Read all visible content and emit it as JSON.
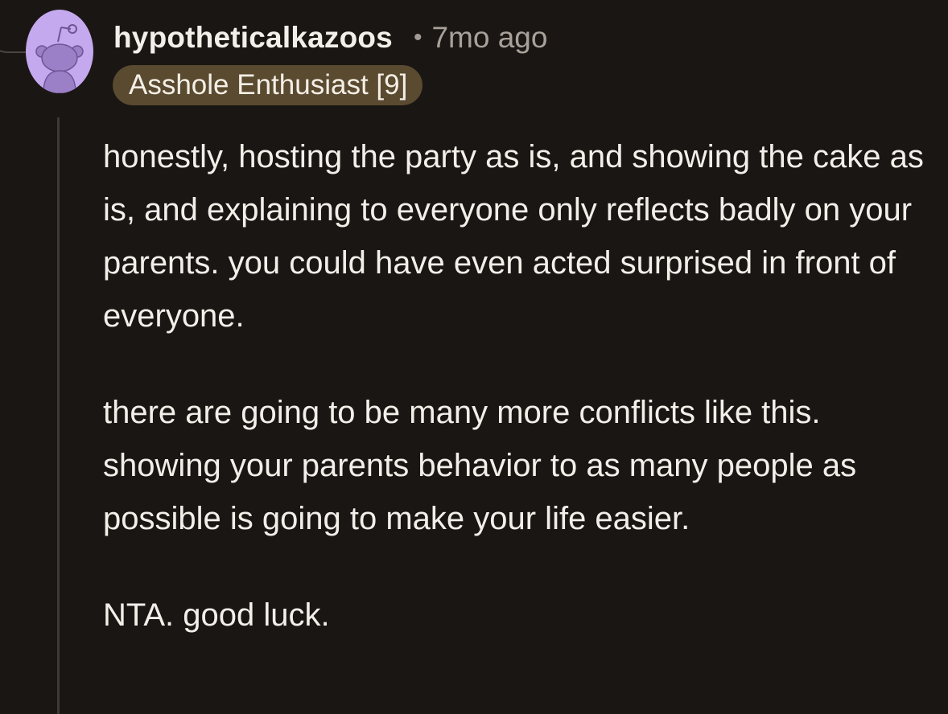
{
  "comment": {
    "username": "hypotheticalkazoos",
    "separator": "•",
    "timestamp": "7mo ago",
    "flair": "Asshole Enthusiast [9]",
    "avatar_icon": "reddit-snoo-avatar-icon",
    "paragraphs": [
      "honestly, hosting the party as is, and showing the cake as is, and explaining to everyone only reflects badly on your parents. you could have even acted surprised in front of everyone.",
      "there are going to be many more conflicts like this. showing your parents behavior to as many people as possible is going to make your life easier.",
      "NTA. good luck."
    ]
  },
  "colors": {
    "background": "#1a1613",
    "avatar_bg": "#c4a9ee",
    "avatar_figure": "#9b7fc7",
    "flair_bg": "#5a4a30",
    "text": "#f2efe9",
    "muted": "#a8a19a"
  }
}
